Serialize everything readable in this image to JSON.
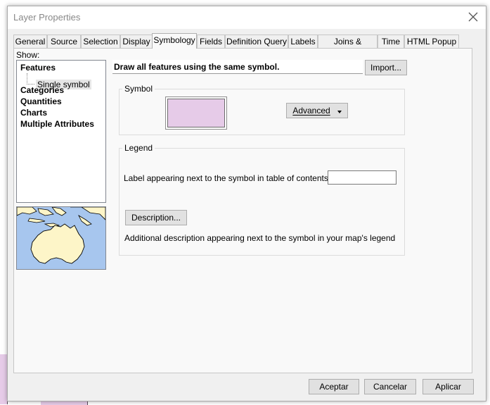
{
  "window": {
    "title": "Layer Properties"
  },
  "tabs": [
    {
      "label": "General"
    },
    {
      "label": "Source"
    },
    {
      "label": "Selection"
    },
    {
      "label": "Display"
    },
    {
      "label": "Symbology"
    },
    {
      "label": "Fields"
    },
    {
      "label": "Definition Query"
    },
    {
      "label": "Labels"
    },
    {
      "label": "Joins & Relates"
    },
    {
      "label": "Time"
    },
    {
      "label": "HTML Popup"
    }
  ],
  "active_tab": "Symbology",
  "show": {
    "label": "Show:",
    "items": [
      "Features",
      "Categories",
      "Quantities",
      "Charts",
      "Multiple Attributes"
    ],
    "sub_item": "Single symbol"
  },
  "symbology": {
    "description": "Draw all features using the same symbol.",
    "import_label": "Import...",
    "symbol_group": "Symbol",
    "symbol_color": "#e6cbe8",
    "advanced_label": "Advanced",
    "legend_group": "Legend",
    "label_text": "Label appearing next to the symbol in table of contents:",
    "label_value": "",
    "description_button": "Description...",
    "description_note": "Additional description appearing next to the symbol in your map's legend"
  },
  "buttons": {
    "ok": "Aceptar",
    "cancel": "Cancelar",
    "apply": "Aplicar"
  },
  "colors": {
    "map_water": "#a7c6ee",
    "map_land": "#fdf5c8"
  }
}
